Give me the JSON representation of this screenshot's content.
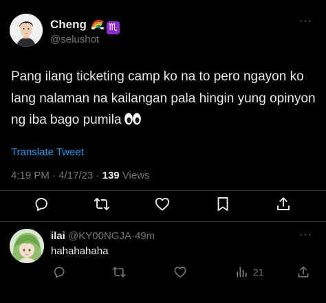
{
  "tweet": {
    "author_name": "Cheng",
    "author_handle": "@selushot",
    "text": "Pang ilang ticketing camp ko na to pero ngayon ko lang nalaman na kailangan pala hingin yung opinyon ng iba bago pumila",
    "emojis": [
      "rainbow-flag",
      "scorpio",
      "eyes"
    ],
    "scorpio_glyph": "♏",
    "translate_label": "Translate Tweet",
    "time": "4:19 PM",
    "date": "4/17/23",
    "separator": "·",
    "views_count": "139",
    "views_label": "Views",
    "more_label": "···"
  },
  "reply": {
    "author_name": "ilai",
    "author_handle": "@KY00NGJA",
    "separator": "·",
    "time_ago": "49m",
    "text": "hahahahaha",
    "views_count": "21",
    "more_label": "···"
  },
  "colors": {
    "background": "#000000",
    "text_primary": "#e7e9ea",
    "text_secondary": "#71767b",
    "link": "#1d9bf0",
    "divider": "#2f3336"
  }
}
